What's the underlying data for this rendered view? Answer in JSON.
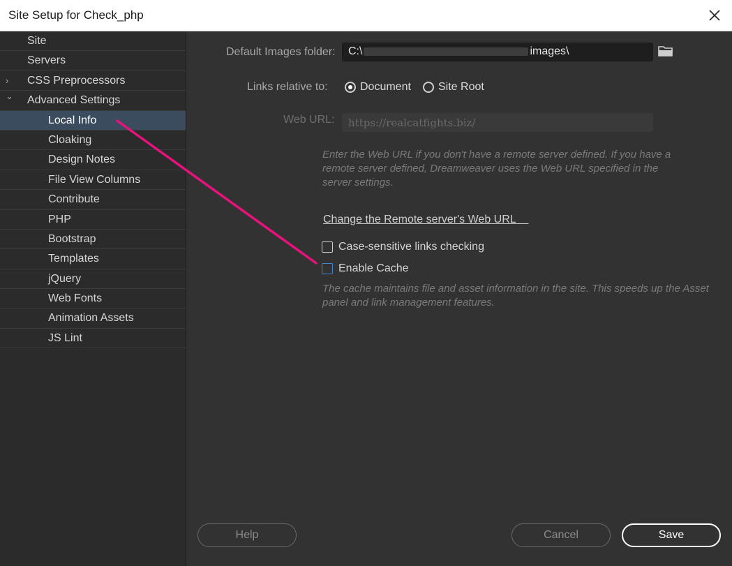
{
  "window": {
    "title": "Site Setup for Check_php",
    "close_icon": "close-icon"
  },
  "sidebar": {
    "items": [
      {
        "label": "Site",
        "level": 0
      },
      {
        "label": "Servers",
        "level": 0
      },
      {
        "label": "CSS Preprocessors",
        "level": 0,
        "chevron": "›"
      },
      {
        "label": "Advanced Settings",
        "level": 0,
        "chevron": "⌄"
      },
      {
        "label": "Local Info",
        "level": 1,
        "selected": true
      },
      {
        "label": "Cloaking",
        "level": 1
      },
      {
        "label": "Design Notes",
        "level": 1
      },
      {
        "label": "File View Columns",
        "level": 1
      },
      {
        "label": "Contribute",
        "level": 1
      },
      {
        "label": "PHP",
        "level": 1
      },
      {
        "label": "Bootstrap",
        "level": 1
      },
      {
        "label": "Templates",
        "level": 1
      },
      {
        "label": "jQuery",
        "level": 1
      },
      {
        "label": "Web Fonts",
        "level": 1
      },
      {
        "label": "Animation Assets",
        "level": 1
      },
      {
        "label": "JS Lint",
        "level": 1
      }
    ]
  },
  "local_info": {
    "images_folder_label": "Default Images folder:",
    "images_folder_prefix": "C:\\",
    "images_folder_suffix": "images\\",
    "links_relative_label": "Links relative to:",
    "radio_document": "Document",
    "radio_site_root": "Site Root",
    "web_url_label": "Web URL:",
    "web_url_value": "https://realcatfights.biz/",
    "web_url_hint": "Enter the Web URL if you don't have a remote server defined. If you have a remote server defined, Dreamweaver uses the Web URL specified in the server settings.",
    "change_url_link": "Change the Remote server's Web URL",
    "case_sensitive_label": "Case-sensitive links checking",
    "enable_cache_label": "Enable Cache",
    "cache_hint": "The cache maintains file and asset information in the site. This speeds up the Asset panel and link management features."
  },
  "buttons": {
    "help": "Help",
    "cancel": "Cancel",
    "save": "Save"
  },
  "colors": {
    "annotation_arrow": "#e8127c",
    "selection": "#3b4c5e",
    "background": "#323232"
  }
}
